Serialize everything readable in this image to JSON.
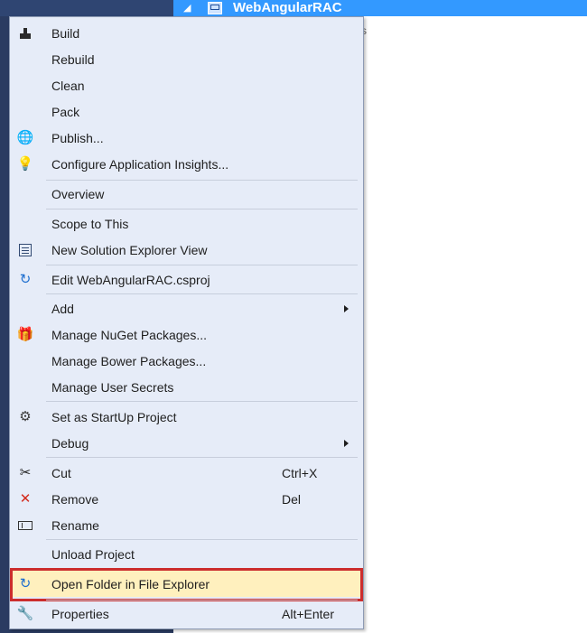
{
  "header": {
    "project_name": "WebAngularRAC",
    "expand_glyph": "◢",
    "stray_mark": "s"
  },
  "menu": {
    "items": [
      {
        "label": "Build",
        "icon": "build-icon"
      },
      {
        "label": "Rebuild",
        "icon": ""
      },
      {
        "label": "Clean",
        "icon": ""
      },
      {
        "label": "Pack",
        "icon": ""
      },
      {
        "label": "Publish...",
        "icon": "globe-publish-icon",
        "glyph": "🌐"
      },
      {
        "label": "Configure Application Insights...",
        "icon": "application-insights-icon",
        "glyph": "💡"
      },
      {
        "label": "Overview",
        "icon": ""
      },
      {
        "label": "Scope to This",
        "icon": ""
      },
      {
        "label": "New Solution Explorer View",
        "icon": "new-solution-explorer-view-icon"
      },
      {
        "label": "Edit WebAngularRAC.csproj",
        "icon": "edit-project-icon",
        "glyph": "↻"
      },
      {
        "label": "Add",
        "icon": "",
        "submenu": true
      },
      {
        "label": "Manage NuGet Packages...",
        "icon": "nuget-packages-icon",
        "glyph": "🎁"
      },
      {
        "label": "Manage Bower Packages...",
        "icon": ""
      },
      {
        "label": "Manage User Secrets",
        "icon": ""
      },
      {
        "label": "Set as StartUp Project",
        "icon": "gear-icon",
        "glyph": "⚙"
      },
      {
        "label": "Debug",
        "icon": "",
        "submenu": true
      },
      {
        "label": "Cut",
        "icon": "scissors-icon",
        "glyph": "✂",
        "shortcut": "Ctrl+X"
      },
      {
        "label": "Remove",
        "icon": "remove-x-icon",
        "glyph": "✕",
        "shortcut": "Del"
      },
      {
        "label": "Rename",
        "icon": "rename-icon"
      },
      {
        "label": "Unload Project",
        "icon": ""
      },
      {
        "label": "Open Folder in File Explorer",
        "icon": "open-folder-icon",
        "glyph": "↻",
        "highlighted": true
      },
      {
        "label": "Properties",
        "icon": "wrench-icon",
        "glyph": "🔧",
        "shortcut": "Alt+Enter"
      }
    ]
  },
  "colors": {
    "menu_background": "#e6ecf8",
    "highlight_background": "#fff0be",
    "highlight_border": "#cc2d2d",
    "selection_blue": "#3399ff",
    "left_panel": "#2a3b61"
  }
}
